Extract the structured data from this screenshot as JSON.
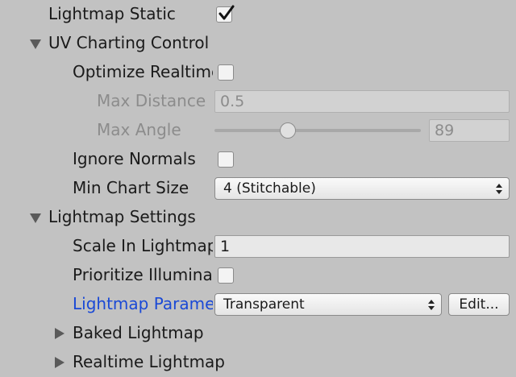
{
  "lightmap_static": {
    "label": "Lightmap Static",
    "checked": true
  },
  "uv_charting": {
    "header": "UV Charting Control",
    "optimize_realtime": {
      "label": "Optimize Realtime UVs",
      "checked": false
    },
    "max_distance": {
      "label": "Max Distance",
      "value": "0.5"
    },
    "max_angle": {
      "label": "Max Angle",
      "value": "89",
      "fraction": 0.356
    },
    "ignore_normals": {
      "label": "Ignore Normals",
      "checked": false
    },
    "min_chart_size": {
      "label": "Min Chart Size",
      "value": "4 (Stitchable)"
    }
  },
  "lightmap_settings": {
    "header": "Lightmap Settings",
    "scale_in_lightmap": {
      "label": "Scale In Lightmap",
      "value": "1"
    },
    "prioritize_illumination": {
      "label": "Prioritize Illumination",
      "checked": false
    },
    "lightmap_parameters": {
      "label": "Lightmap Parameters",
      "value": "Transparent",
      "edit_label": "Edit..."
    },
    "baked_lightmap": {
      "label": "Baked Lightmap"
    },
    "realtime_lightmap": {
      "label": "Realtime Lightmap"
    }
  }
}
